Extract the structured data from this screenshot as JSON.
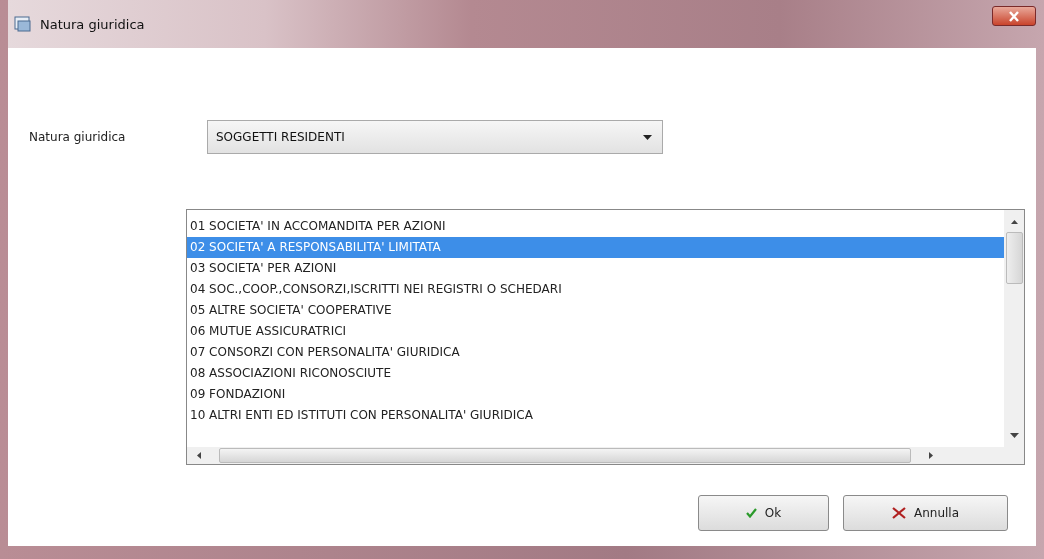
{
  "window": {
    "title": "Natura giuridica"
  },
  "field": {
    "label": "Natura giuridica",
    "value": "SOGGETTI RESIDENTI"
  },
  "list": {
    "items": [
      {
        "text": "01 SOCIETA' IN ACCOMANDITA PER AZIONI",
        "selected": false
      },
      {
        "text": "02 SOCIETA' A RESPONSABILITA' LIMITATA",
        "selected": true
      },
      {
        "text": "03 SOCIETA' PER AZIONI",
        "selected": false
      },
      {
        "text": "04 SOC.,COOP.,CONSORZI,ISCRITTI NEI REGISTRI O SCHEDARI",
        "selected": false
      },
      {
        "text": "05 ALTRE SOCIETA' COOPERATIVE",
        "selected": false
      },
      {
        "text": "06 MUTUE ASSICURATRICI",
        "selected": false
      },
      {
        "text": "07 CONSORZI CON PERSONALITA' GIURIDICA",
        "selected": false
      },
      {
        "text": "08 ASSOCIAZIONI RICONOSCIUTE",
        "selected": false
      },
      {
        "text": "09 FONDAZIONI",
        "selected": false
      },
      {
        "text": "10 ALTRI ENTI ED ISTITUTI CON PERSONALITA' GIURIDICA",
        "selected": false
      }
    ]
  },
  "buttons": [
    {
      "kind": "ok",
      "label": "Ok"
    },
    {
      "kind": "cancel",
      "label": "Annulla"
    }
  ]
}
